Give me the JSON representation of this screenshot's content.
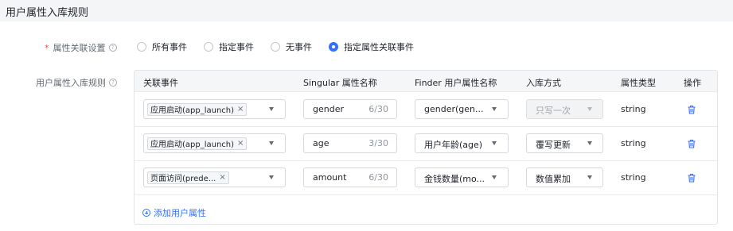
{
  "page": {
    "title": "用户属性入库规则"
  },
  "association": {
    "label": "属性关联设置",
    "help": "?",
    "options": [
      {
        "label": "所有事件",
        "checked": false
      },
      {
        "label": "指定事件",
        "checked": false
      },
      {
        "label": "无事件",
        "checked": false
      },
      {
        "label": "指定属性关联事件",
        "checked": true
      }
    ]
  },
  "rules": {
    "label": "用户属性入库规则",
    "help": "?",
    "columns": [
      "关联事件",
      "Singular 属性名称",
      "Finder 用户属性名称",
      "入库方式",
      "属性类型",
      "操作"
    ],
    "rows": [
      {
        "event_tag": "应用启动(app_launch)",
        "tag_close": "×",
        "singular_name": "gender",
        "count": "6/30",
        "finder_name": "gender(gen...",
        "storage_method": "只写一次",
        "storage_disabled": true,
        "type": "string",
        "action_icon": "trash-icon"
      },
      {
        "event_tag": "应用启动(app_launch)",
        "tag_close": "×",
        "singular_name": "age",
        "count": "3/30",
        "finder_name": "用户年龄(age)",
        "storage_method": "覆写更新",
        "storage_disabled": false,
        "type": "string",
        "action_icon": "trash-icon"
      },
      {
        "event_tag": "页面访问(prede...",
        "tag_close": "×",
        "singular_name": "amount",
        "count": "6/30",
        "finder_name": "金钱数量(mo...",
        "storage_method": "数值累加",
        "storage_disabled": false,
        "type": "string",
        "action_icon": "trash-icon"
      }
    ],
    "add_label": "添加用户属性"
  },
  "colors": {
    "accent": "#3370ff",
    "required": "#f54a45",
    "header_bg": "#f4f5f7"
  }
}
